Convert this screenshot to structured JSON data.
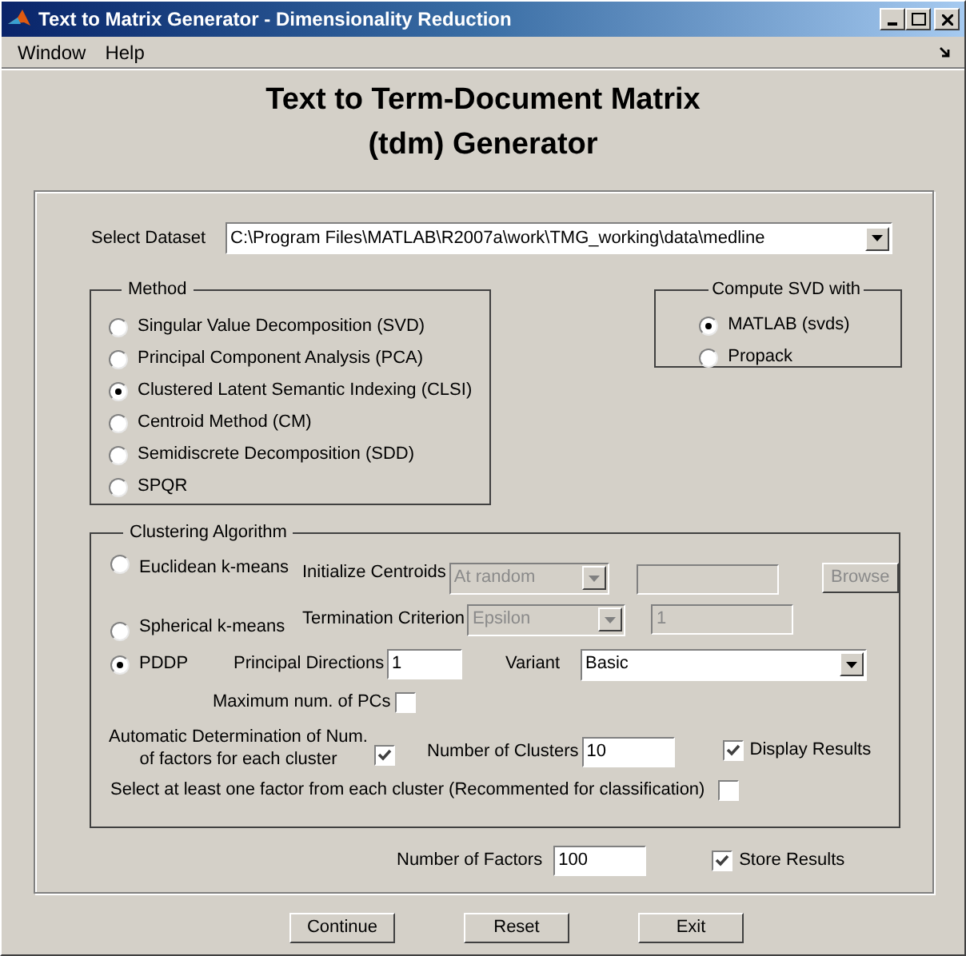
{
  "window": {
    "title": "Text to Matrix Generator - Dimensionality Reduction"
  },
  "menu": [
    "Window",
    "Help"
  ],
  "heading": [
    "Text to Term-Document Matrix",
    "(tdm) Generator"
  ],
  "dataset": {
    "label": "Select Dataset",
    "value": "C:\\Program Files\\MATLAB\\R2007a\\work\\TMG_working\\data\\medline"
  },
  "method": {
    "title": "Method",
    "options": [
      {
        "label": "Singular Value Decomposition (SVD)",
        "selected": false
      },
      {
        "label": "Principal Component Analysis (PCA)",
        "selected": false
      },
      {
        "label": "Clustered Latent Semantic Indexing (CLSI)",
        "selected": true
      },
      {
        "label": "Centroid Method (CM)",
        "selected": false
      },
      {
        "label": "Semidiscrete Decomposition (SDD)",
        "selected": false
      },
      {
        "label": "SPQR",
        "selected": false
      }
    ]
  },
  "svd": {
    "title": "Compute SVD with",
    "options": [
      {
        "label": "MATLAB (svds)",
        "selected": true
      },
      {
        "label": "Propack",
        "selected": false
      }
    ]
  },
  "clustering": {
    "title": "Clustering Algorithm",
    "algorithms": [
      {
        "label": "Euclidean k-means",
        "selected": false
      },
      {
        "label": "Spherical k-means",
        "selected": false
      },
      {
        "label": "PDDP",
        "selected": true
      }
    ],
    "init_centroids": {
      "label": "Initialize Centroids",
      "value": "At random",
      "disabled": true
    },
    "init_file": {
      "disabled": true
    },
    "browse": {
      "label": "Browse",
      "disabled": true
    },
    "termination": {
      "label": "Termination Criterion",
      "value": "Epsilon",
      "disabled": true
    },
    "termination_value": {
      "value": "1",
      "disabled": true
    },
    "principal_directions": {
      "label": "Principal Directions",
      "value": "1"
    },
    "variant": {
      "label": "Variant",
      "value": "Basic"
    },
    "max_pcs": {
      "label": "Maximum num. of PCs",
      "checked": false
    },
    "auto_factors": {
      "label": "Automatic Determination of Num.\nof factors for each cluster",
      "checked": true
    },
    "num_clusters": {
      "label": "Number of Clusters",
      "value": "10"
    },
    "display_results": {
      "label": "Display Results",
      "checked": true
    },
    "select_one": {
      "label": "Select at least one factor from each cluster (Recommented for classification)",
      "checked": false
    }
  },
  "factors": {
    "label": "Number of Factors",
    "value": "100"
  },
  "store_results": {
    "label": "Store Results",
    "checked": true
  },
  "buttons": [
    "Continue",
    "Reset",
    "Exit"
  ]
}
